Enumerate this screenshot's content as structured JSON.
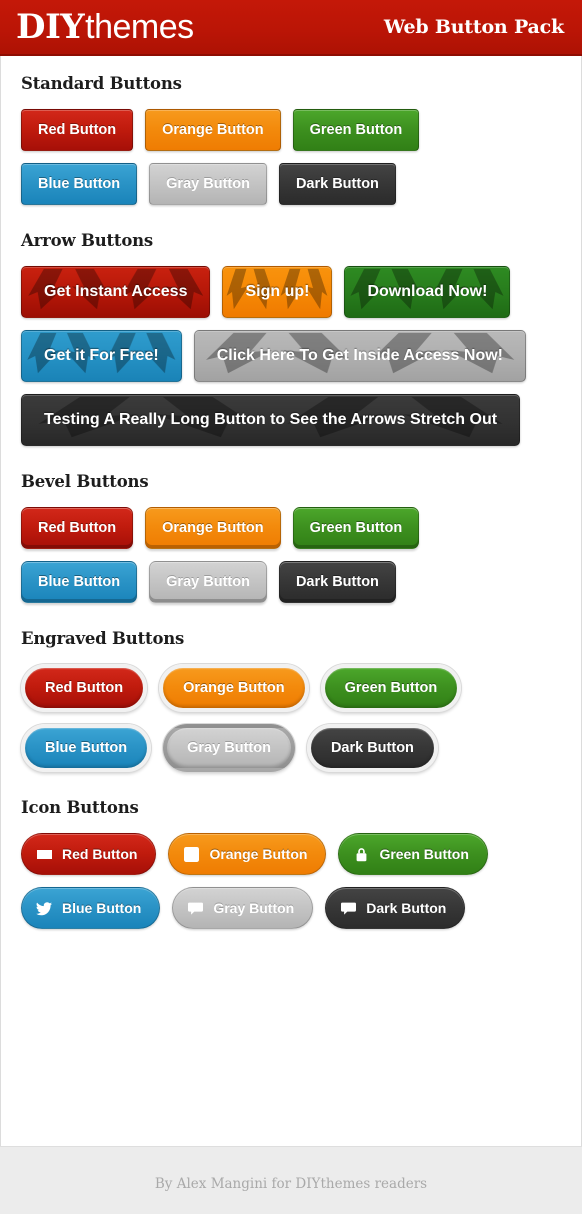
{
  "header": {
    "logo_bold": "DIY",
    "logo_light": "themes",
    "title": "Web Button Pack",
    "bg_color": "#bb1506"
  },
  "sections": [
    {
      "id": "standard",
      "title": "Standard Buttons",
      "rows": [
        [
          {
            "label": "Red Button",
            "color": "red",
            "hex": "#c01b0d"
          },
          {
            "label": "Orange Button",
            "color": "orange",
            "hex": "#f38a0c"
          },
          {
            "label": "Green Button",
            "color": "green",
            "hex": "#3d901f"
          }
        ],
        [
          {
            "label": "Blue Button",
            "color": "blue",
            "hex": "#2a93c6"
          },
          {
            "label": "Gray Button",
            "color": "gray",
            "hex": "#c4c4c4"
          },
          {
            "label": "Dark Button",
            "color": "dark",
            "hex": "#373737"
          }
        ]
      ]
    },
    {
      "id": "arrow",
      "title": "Arrow Buttons",
      "rows": [
        [
          {
            "label": "Get Instant Access",
            "color": "red",
            "hex": "#b41708"
          },
          {
            "label": "Sign up!",
            "color": "orange",
            "hex": "#f58704"
          },
          {
            "label": "Download Now!",
            "color": "green",
            "hex": "#277b1c"
          }
        ],
        [
          {
            "label": "Get it For Free!",
            "color": "blue",
            "hex": "#2490c3"
          },
          {
            "label": "Click Here To Get Inside Access Now!",
            "color": "gray",
            "hex": "#aeaeae"
          }
        ],
        [
          {
            "label": "Testing A Really Long Button to See the Arrows Stretch Out",
            "color": "dark",
            "hex": "#323232"
          }
        ]
      ]
    },
    {
      "id": "bevel",
      "title": "Bevel Buttons",
      "rows": [
        [
          {
            "label": "Red Button",
            "color": "red",
            "hex": "#c01b0d"
          },
          {
            "label": "Orange Button",
            "color": "orange",
            "hex": "#f38a0c"
          },
          {
            "label": "Green Button",
            "color": "green",
            "hex": "#3d901f"
          }
        ],
        [
          {
            "label": "Blue Button",
            "color": "blue",
            "hex": "#2a93c6"
          },
          {
            "label": "Gray Button",
            "color": "gray",
            "hex": "#c4c4c4"
          },
          {
            "label": "Dark Button",
            "color": "dark",
            "hex": "#373737"
          }
        ]
      ]
    },
    {
      "id": "engraved",
      "title": "Engraved Buttons",
      "rows": [
        [
          {
            "label": "Red Button",
            "color": "red",
            "hex": "#c01b0d"
          },
          {
            "label": "Orange Button",
            "color": "orange",
            "hex": "#f38a0c"
          },
          {
            "label": "Green Button",
            "color": "green",
            "hex": "#3d901f"
          }
        ],
        [
          {
            "label": "Blue Button",
            "color": "blue",
            "hex": "#2a93c6"
          },
          {
            "label": "Gray Button",
            "color": "gray",
            "hex": "#c4c4c4"
          },
          {
            "label": "Dark Button",
            "color": "dark",
            "hex": "#373737"
          }
        ]
      ]
    },
    {
      "id": "icon",
      "title": "Icon Buttons",
      "rows": [
        [
          {
            "label": "Red Button",
            "color": "red",
            "hex": "#c01b0d",
            "icon": "tag-icon"
          },
          {
            "label": "Orange Button",
            "color": "orange",
            "hex": "#f38a0c",
            "icon": "rss-icon"
          },
          {
            "label": "Green Button",
            "color": "green",
            "hex": "#3d901f",
            "icon": "lock-icon"
          }
        ],
        [
          {
            "label": "Blue Button",
            "color": "blue",
            "hex": "#2a93c6",
            "icon": "twitter-bird-icon"
          },
          {
            "label": "Gray Button",
            "color": "gray",
            "hex": "#c4c4c4",
            "icon": "speech-bubble-icon"
          },
          {
            "label": "Dark Button",
            "color": "dark",
            "hex": "#373737",
            "icon": "speech-bubble-icon"
          }
        ]
      ]
    }
  ],
  "footer": {
    "text": "By Alex Mangini for DIYthemes readers"
  }
}
